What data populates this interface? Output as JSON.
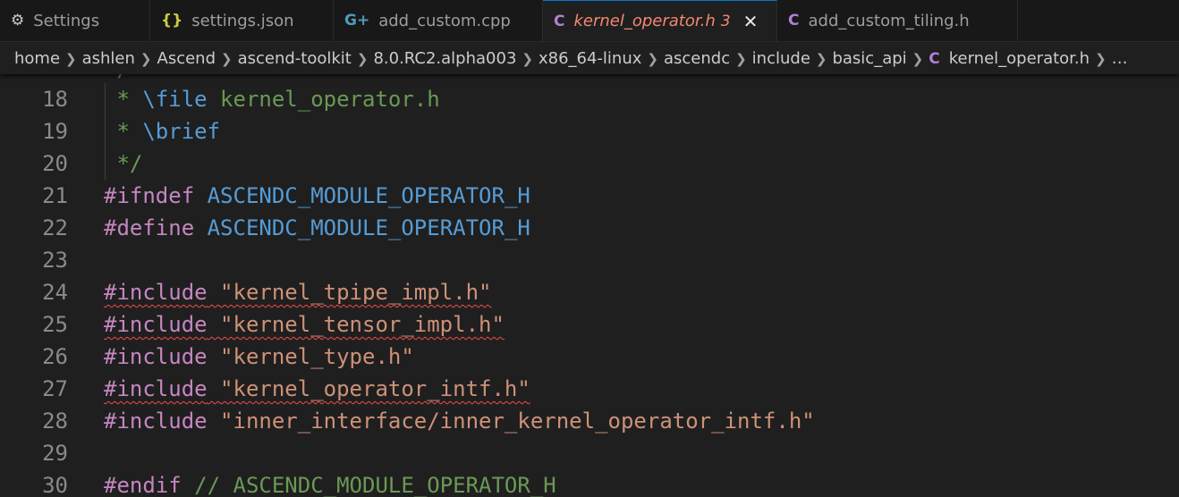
{
  "tabs": [
    {
      "icon": "settings-icon",
      "glyph": "⚙",
      "label": "Settings",
      "active": false
    },
    {
      "icon": "json-icon",
      "glyph": "{}",
      "label": "settings.json",
      "active": false
    },
    {
      "icon": "cpp-icon",
      "glyph": "G+",
      "label": "add_custom.cpp",
      "active": false
    },
    {
      "icon": "c-icon",
      "glyph": "C",
      "label": "kernel_operator.h",
      "badge": "3",
      "active": true
    },
    {
      "icon": "c-icon",
      "glyph": "C",
      "label": "add_custom_tiling.h",
      "active": false
    }
  ],
  "breadcrumb": {
    "items": [
      "home",
      "ashlen",
      "Ascend",
      "ascend-toolkit",
      "8.0.RC2.alpha003",
      "x86_64-linux",
      "ascendc",
      "include",
      "basic_api"
    ],
    "file": "kernel_operator.h",
    "more": "…"
  },
  "editor": {
    "lines": [
      {
        "num": "18",
        "parts": [
          {
            "t": " * ",
            "c": "comment"
          },
          {
            "t": "\\file",
            "c": "doc"
          },
          {
            "t": " kernel_operator.h",
            "c": "comment"
          }
        ]
      },
      {
        "num": "19",
        "parts": [
          {
            "t": " * ",
            "c": "comment"
          },
          {
            "t": "\\brief",
            "c": "doc"
          }
        ]
      },
      {
        "num": "20",
        "parts": [
          {
            "t": " */",
            "c": "comment"
          }
        ]
      },
      {
        "num": "21",
        "parts": [
          {
            "t": "#ifndef",
            "c": "pp"
          },
          {
            "t": " ",
            "c": ""
          },
          {
            "t": "ASCENDC_MODULE_OPERATOR_H",
            "c": "macro"
          }
        ]
      },
      {
        "num": "22",
        "parts": [
          {
            "t": "#define",
            "c": "pp"
          },
          {
            "t": " ",
            "c": ""
          },
          {
            "t": "ASCENDC_MODULE_OPERATOR_H",
            "c": "macro"
          }
        ]
      },
      {
        "num": "23",
        "parts": []
      },
      {
        "num": "24",
        "squiggle": true,
        "parts": [
          {
            "t": "#include",
            "c": "pp"
          },
          {
            "t": " ",
            "c": ""
          },
          {
            "t": "\"kernel_tpipe_impl.h\"",
            "c": "str"
          }
        ]
      },
      {
        "num": "25",
        "squiggle": true,
        "parts": [
          {
            "t": "#include",
            "c": "pp"
          },
          {
            "t": " ",
            "c": ""
          },
          {
            "t": "\"kernel_tensor_impl.h\"",
            "c": "str"
          }
        ]
      },
      {
        "num": "26",
        "parts": [
          {
            "t": "#include",
            "c": "pp"
          },
          {
            "t": " ",
            "c": ""
          },
          {
            "t": "\"kernel_type.h\"",
            "c": "str"
          }
        ]
      },
      {
        "num": "27",
        "squiggle": true,
        "parts": [
          {
            "t": "#include",
            "c": "pp"
          },
          {
            "t": " ",
            "c": ""
          },
          {
            "t": "\"kernel_operator_intf.h\"",
            "c": "str"
          }
        ]
      },
      {
        "num": "28",
        "parts": [
          {
            "t": "#include",
            "c": "pp"
          },
          {
            "t": " ",
            "c": ""
          },
          {
            "t": "\"inner_interface/inner_kernel_operator_intf.h\"",
            "c": "str"
          }
        ]
      },
      {
        "num": "29",
        "parts": []
      },
      {
        "num": "30",
        "parts": [
          {
            "t": "#endif",
            "c": "pp"
          },
          {
            "t": " // ASCENDC_MODULE_OPERATOR_H",
            "c": "comment"
          }
        ]
      }
    ]
  },
  "colors": {
    "active_tab_text": "#f48771",
    "c_icon": "#b180d7",
    "json_icon": "#cbcb41",
    "cpp_icon": "#519aba",
    "comment": "#6a9955",
    "preprocessor": "#c586c0",
    "macro": "#569cd6",
    "string": "#ce9178",
    "error_squiggle": "#f14c4c"
  }
}
